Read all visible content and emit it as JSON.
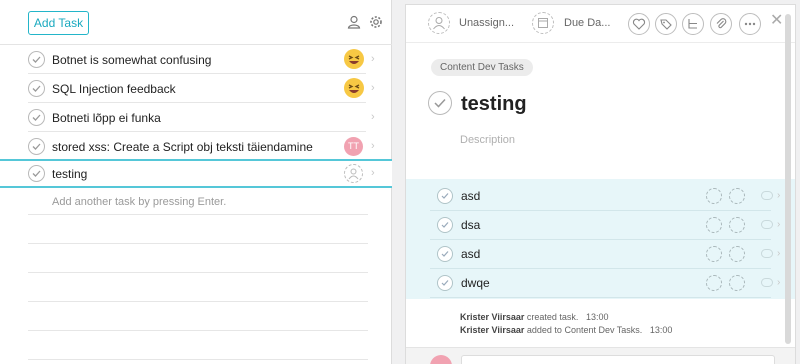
{
  "left": {
    "add_task_label": "Add Task",
    "tasks": [
      {
        "name": "Botnet is somewhat confusing",
        "assignee": "emoji"
      },
      {
        "name": "SQL Injection feedback",
        "assignee": "emoji"
      },
      {
        "name": "Botneti lõpp ei funka",
        "assignee": "none"
      },
      {
        "name": "stored xss: Create a Script obj teksti täiendamine",
        "assignee": "TT"
      },
      {
        "name": "testing",
        "assignee": "empty",
        "selected": true
      }
    ],
    "hint": "Add another task by pressing Enter."
  },
  "right": {
    "assignee_label": "Unassign...",
    "due_label": "Due Da...",
    "project_tag": "Content Dev Tasks",
    "title": "testing",
    "description_placeholder": "Description",
    "subtasks": [
      "asd",
      "dsa",
      "asd",
      "dwqe"
    ],
    "activity": [
      {
        "user": "Krister Viirsaar",
        "action": "created task.",
        "time": "13:00"
      },
      {
        "user": "Krister Viirsaar",
        "action": "added to Content Dev Tasks.",
        "time": "13:00"
      }
    ]
  },
  "colors": {
    "accent": "#1aa9bf",
    "selected_border": "#55c7d8",
    "subtask_bg": "#e7f6f9"
  }
}
